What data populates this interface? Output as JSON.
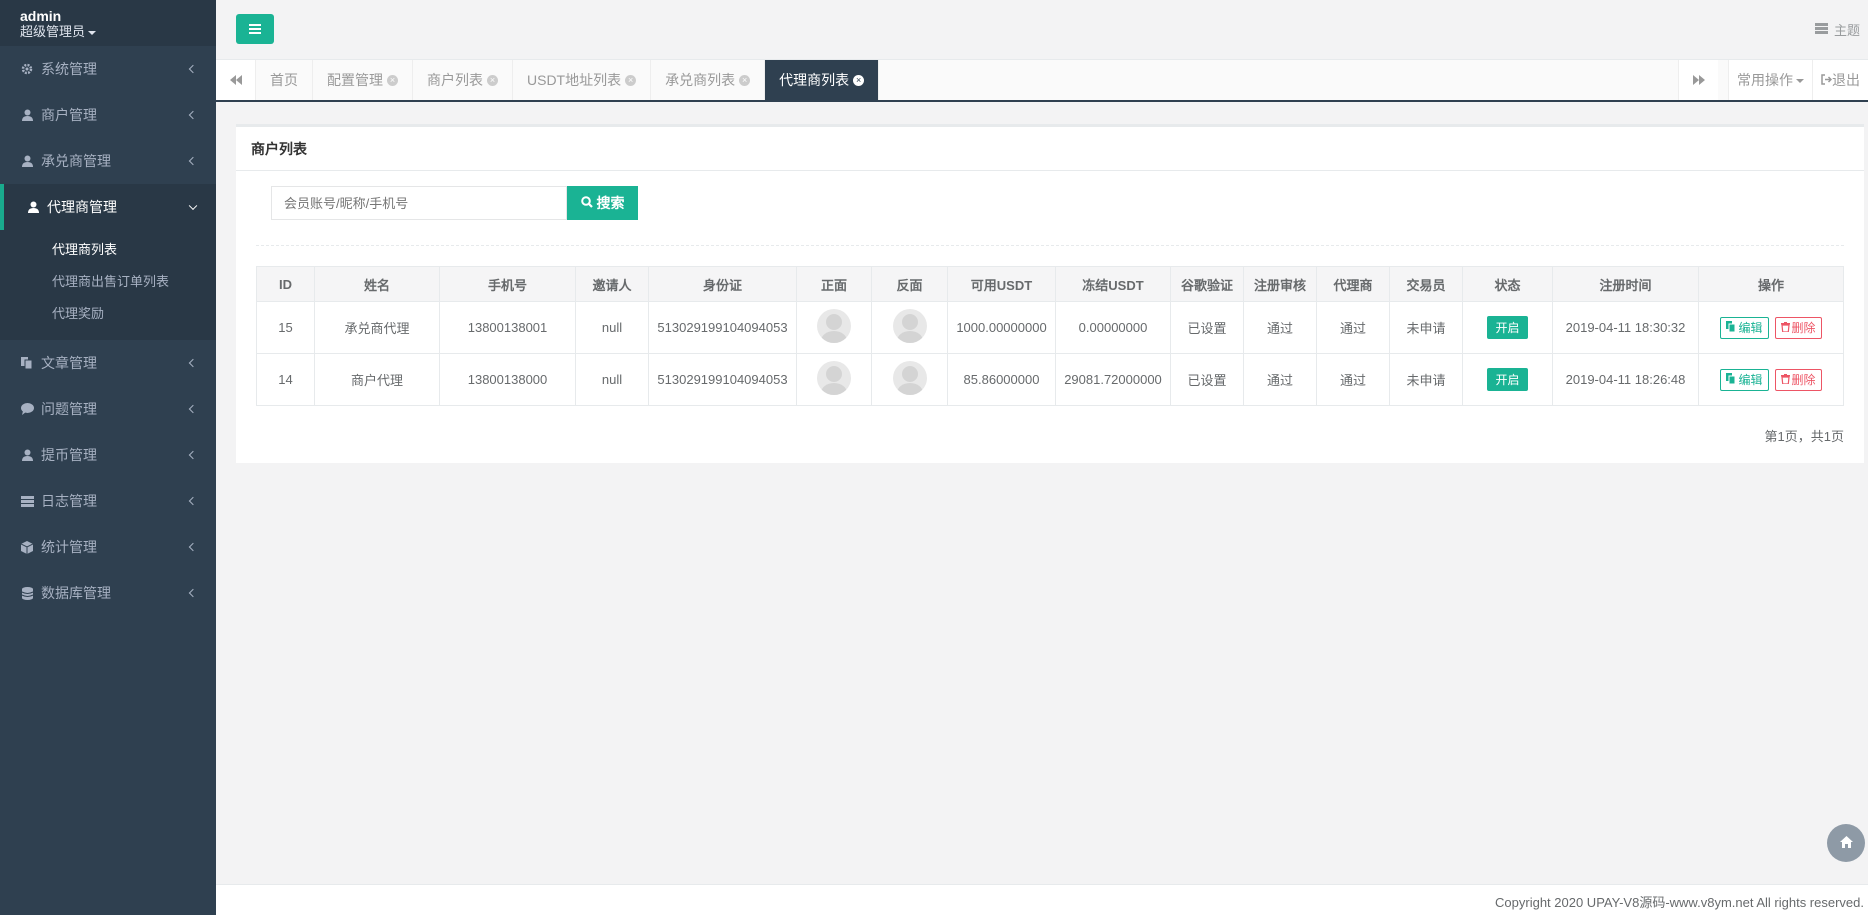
{
  "profile": {
    "name": "admin",
    "role": "超级管理员"
  },
  "sidebar": {
    "items": [
      {
        "label": "系统管理",
        "icon": "gear-icon"
      },
      {
        "label": "商户管理",
        "icon": "user-icon"
      },
      {
        "label": "承兑商管理",
        "icon": "user-icon"
      },
      {
        "label": "代理商管理",
        "icon": "user-icon"
      },
      {
        "label": "文章管理",
        "icon": "copy-icon"
      },
      {
        "label": "问题管理",
        "icon": "comment-icon"
      },
      {
        "label": "提币管理",
        "icon": "user-icon"
      },
      {
        "label": "日志管理",
        "icon": "list-icon"
      },
      {
        "label": "统计管理",
        "icon": "cube-icon"
      },
      {
        "label": "数据库管理",
        "icon": "database-icon"
      }
    ],
    "submenu": [
      "代理商列表",
      "代理商出售订单列表",
      "代理奖励"
    ]
  },
  "header": {
    "theme_label": "主题"
  },
  "tabs": [
    "首页",
    "配置管理",
    "商户列表",
    "USDT地址列表",
    "承兑商列表",
    "代理商列表"
  ],
  "tab_ops": {
    "common": "常用操作",
    "logout": "退出"
  },
  "panel": {
    "title": "商户列表",
    "search_placeholder": "会员账号/昵称/手机号",
    "search_button": "搜索"
  },
  "table": {
    "headers": [
      "ID",
      "姓名",
      "手机号",
      "邀请人",
      "身份证",
      "正面",
      "反面",
      "可用USDT",
      "冻结USDT",
      "谷歌验证",
      "注册审核",
      "代理商",
      "交易员",
      "状态",
      "注册时间",
      "操作"
    ],
    "rows": [
      {
        "id": "15",
        "name": "承兑商代理",
        "phone": "13800138001",
        "inviter": "null",
        "idcard": "513029199104094053",
        "usdt": "1000.00000000",
        "frozen": "0.00000000",
        "google": "已设置",
        "review": "通过",
        "agent": "通过",
        "trader": "未申请",
        "status": "开启",
        "time": "2019-04-11 18:30:32"
      },
      {
        "id": "14",
        "name": "商户代理",
        "phone": "13800138000",
        "inviter": "null",
        "idcard": "513029199104094053",
        "usdt": "85.86000000",
        "frozen": "29081.72000000",
        "google": "已设置",
        "review": "通过",
        "agent": "通过",
        "trader": "未申请",
        "status": "开启",
        "time": "2019-04-11 18:26:48"
      }
    ],
    "edit_label": "编辑",
    "delete_label": "删除"
  },
  "pager": "第1页，共1页",
  "footer": "Copyright 2020 UPAY-V8源码-www.v8ym.net All rights reserved.",
  "colors": {
    "sidebar": "#2f4050",
    "accent": "#1ab394",
    "danger": "#ed5565"
  }
}
